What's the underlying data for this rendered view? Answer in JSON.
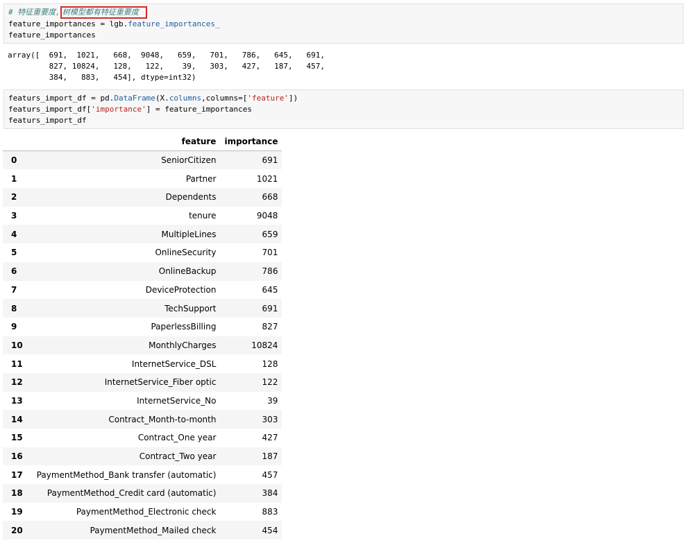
{
  "cell1": {
    "comment_prefix": "# 特征重要度,",
    "comment_highlight": "树模型都有特征重要度",
    "line2_var": "feature_importances = lgb.",
    "line2_attr": "feature_importances_",
    "line3": "feature_importances"
  },
  "out1": {
    "lines": [
      "array([  691,  1021,   668,  9048,   659,   701,   786,   645,   691,",
      "         827, 10824,   128,   122,    39,   303,   427,   187,   457,",
      "         384,   883,   454], dtype=int32)"
    ]
  },
  "cell2": {
    "l1_a": "featurs_import_df = pd.",
    "l1_b": "DataFrame",
    "l1_c": "(X.",
    "l1_d": "columns",
    "l1_e": ",columns=[",
    "l1_f": "'feature'",
    "l1_g": "])",
    "l2_a": "featurs_import_df[",
    "l2_b": "'importance'",
    "l2_c": "] = feature_importances",
    "l3": "featurs_import_df"
  },
  "table": {
    "columns": [
      "",
      "feature",
      "importance"
    ],
    "rows": [
      {
        "index": "0",
        "feature": "SeniorCitizen",
        "importance": "691"
      },
      {
        "index": "1",
        "feature": "Partner",
        "importance": "1021"
      },
      {
        "index": "2",
        "feature": "Dependents",
        "importance": "668"
      },
      {
        "index": "3",
        "feature": "tenure",
        "importance": "9048"
      },
      {
        "index": "4",
        "feature": "MultipleLines",
        "importance": "659"
      },
      {
        "index": "5",
        "feature": "OnlineSecurity",
        "importance": "701"
      },
      {
        "index": "6",
        "feature": "OnlineBackup",
        "importance": "786"
      },
      {
        "index": "7",
        "feature": "DeviceProtection",
        "importance": "645"
      },
      {
        "index": "8",
        "feature": "TechSupport",
        "importance": "691"
      },
      {
        "index": "9",
        "feature": "PaperlessBilling",
        "importance": "827"
      },
      {
        "index": "10",
        "feature": "MonthlyCharges",
        "importance": "10824"
      },
      {
        "index": "11",
        "feature": "InternetService_DSL",
        "importance": "128"
      },
      {
        "index": "12",
        "feature": "InternetService_Fiber optic",
        "importance": "122"
      },
      {
        "index": "13",
        "feature": "InternetService_No",
        "importance": "39"
      },
      {
        "index": "14",
        "feature": "Contract_Month-to-month",
        "importance": "303"
      },
      {
        "index": "15",
        "feature": "Contract_One year",
        "importance": "427"
      },
      {
        "index": "16",
        "feature": "Contract_Two year",
        "importance": "187"
      },
      {
        "index": "17",
        "feature": "PaymentMethod_Bank transfer (automatic)",
        "importance": "457"
      },
      {
        "index": "18",
        "feature": "PaymentMethod_Credit card (automatic)",
        "importance": "384"
      },
      {
        "index": "19",
        "feature": "PaymentMethod_Electronic check",
        "importance": "883"
      },
      {
        "index": "20",
        "feature": "PaymentMethod_Mailed check",
        "importance": "454"
      }
    ]
  },
  "colors": {
    "highlight_border": "#d62828",
    "cell_background": "#f7f7f7"
  }
}
